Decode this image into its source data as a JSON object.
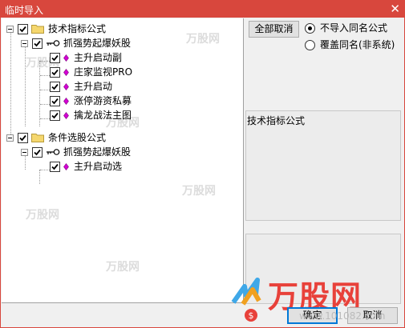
{
  "window": {
    "title": "临时导入",
    "close_glyph": "✕"
  },
  "tree": [
    {
      "key": "root1",
      "label": "技术指标公式",
      "checked": true,
      "icon": "folder-icon"
    },
    {
      "key": "grp1",
      "label": "抓强势起爆妖股",
      "checked": true,
      "icon": "key-icon"
    },
    {
      "key": "leaf1",
      "label": "主升启动副",
      "checked": true,
      "icon": "diamond-icon"
    },
    {
      "key": "leaf2",
      "label": "庄家监视PRO",
      "checked": true,
      "icon": "diamond-icon"
    },
    {
      "key": "leaf3",
      "label": "主升启动",
      "checked": true,
      "icon": "diamond-icon"
    },
    {
      "key": "leaf4",
      "label": "涨停游资私募",
      "checked": true,
      "icon": "diamond-icon"
    },
    {
      "key": "leaf5",
      "label": "擒龙战法主图",
      "checked": true,
      "icon": "diamond-icon"
    },
    {
      "key": "root2",
      "label": "条件选股公式",
      "checked": true,
      "icon": "folder-icon"
    },
    {
      "key": "grp2",
      "label": "抓强势起爆妖股",
      "checked": true,
      "icon": "key-icon"
    },
    {
      "key": "leaf6",
      "label": "主升启动选",
      "checked": true,
      "icon": "diamond-icon"
    }
  ],
  "controls": {
    "cancel_all_label": "全部取消",
    "radio_no_import": "不导入同名公式",
    "radio_overwrite": "覆盖同名(非系统)",
    "selected_radio": "no_import",
    "confirm_label": "确定",
    "cancel_label": "取消"
  },
  "info_panel": {
    "type_label": "技术指标公式"
  },
  "watermark": {
    "brand": "万股网",
    "url": "www.101082.com",
    "tile_text": "万股网"
  },
  "colors": {
    "title_bar": "#d8473d",
    "brand_red": "#e8413a",
    "diamond": "#d400d4"
  }
}
